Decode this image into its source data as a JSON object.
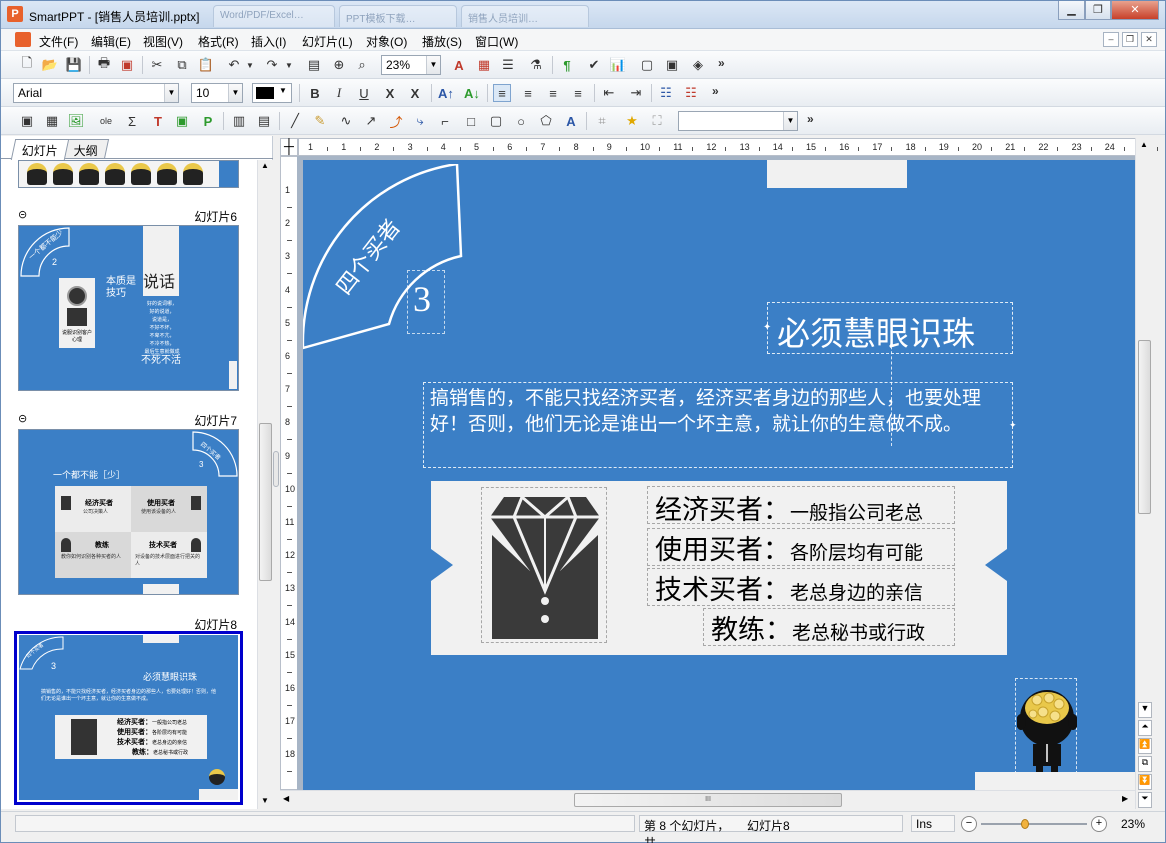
{
  "window": {
    "app_name": "SmartPPT",
    "title": "SmartPPT - [销售人员培训.pptx]",
    "app_icon": "P",
    "ghost_tabs": [
      "Word/PDF/Excel…",
      "PPT模板下载…",
      "销售人员培训…"
    ]
  },
  "menu": [
    "文件(F)",
    "编辑(E)",
    "视图(V)",
    "格式(R)",
    "插入(I)",
    "幻灯片(L)",
    "对象(O)",
    "播放(S)",
    "窗口(W)"
  ],
  "toolbar1": {
    "zoom_value": "23%",
    "overflow": "»"
  },
  "toolbar2": {
    "font_name": "Arial",
    "font_size": "10",
    "bold": "B",
    "italic": "I",
    "underline": "U",
    "strike": "X",
    "overflow": "»"
  },
  "toolbar3": {
    "combo_value": "",
    "overflow": "»"
  },
  "panel": {
    "tabs": [
      "幻灯片",
      "大纲"
    ],
    "slides": [
      {
        "label": "幻灯片6"
      },
      {
        "label": "幻灯片7"
      },
      {
        "label": "幻灯片8"
      }
    ],
    "thumb6": {
      "arc_text": "一个都不能少",
      "number": "2",
      "line1": "本质是",
      "line2": "技巧",
      "big": "说话",
      "center_lines": [
        "好的说词哪，",
        "好的说道，",
        "说道是，",
        "不好不坏，",
        "不卑不亢，",
        "不冷不热，",
        "最后生意就做成"
      ],
      "bottom": "不死不活",
      "left_caption": "说服识别客户心理"
    },
    "thumb7": {
      "title": "一个都不能［少］",
      "arc_text": "四个买者",
      "number": "3",
      "q1": "经济买者",
      "q1_sub": "公司决策人",
      "q2": "使用买者",
      "q2_sub": "使用该设备的人",
      "q3": "教练",
      "q3_sub": "教你如何识别各种买者的人",
      "q4": "技术买者",
      "q4_sub": "对设备的技术层面进行把关的人"
    }
  },
  "slide": {
    "arc_text": "四个买者",
    "number": "3",
    "title": "必须慧眼识珠",
    "body": "搞销售的，不能只找经济买者，经济买者身边的那些人，也要处理好！否则，他们无论是谁出一个坏主意，就让你的生意做不成。",
    "items": [
      {
        "term": "经济买者：",
        "desc": "一般指公司老总"
      },
      {
        "term": "使用买者：",
        "desc": "各阶层均有可能"
      },
      {
        "term": "技术买者：",
        "desc": "老总身边的亲信"
      },
      {
        "term": "教练：",
        "desc": "老总秘书或行政"
      }
    ]
  },
  "rulers": {
    "h_ticks": [
      "1",
      "1",
      "2",
      "3",
      "4",
      "5",
      "6",
      "7",
      "8",
      "9",
      "10",
      "11",
      "12",
      "13",
      "14",
      "15",
      "16",
      "17",
      "18",
      "19",
      "20",
      "21",
      "22",
      "23",
      "24",
      "25"
    ],
    "v_ticks": [
      "1",
      "2",
      "3",
      "4",
      "5",
      "6",
      "7",
      "8",
      "9",
      "10",
      "11",
      "12",
      "13",
      "14",
      "15",
      "16",
      "17",
      "18"
    ]
  },
  "hscroll_label": "III",
  "status": {
    "slide_info": "第 8 个幻灯片，共",
    "slide_name": "幻灯片8",
    "mode": "Ins",
    "zoom": "23%"
  },
  "colors": {
    "slide_bg": "#3b7fc6",
    "selection": "#0000cc",
    "panel_band": "#f1f1f1"
  }
}
